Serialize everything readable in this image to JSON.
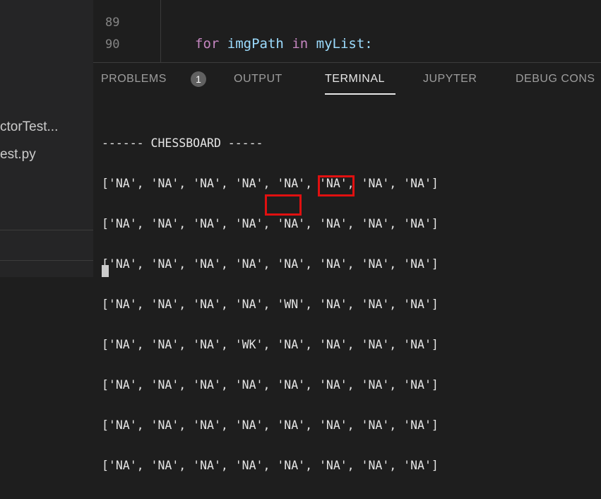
{
  "sidebar": {
    "files": [
      "ctorTest...",
      "est.py"
    ]
  },
  "editor": {
    "line_numbers": [
      "89",
      "90"
    ],
    "code": {
      "kw_for": "for",
      "var": "imgPath",
      "kw_in": "in",
      "rest": "myList:"
    }
  },
  "panel": {
    "tabs": [
      {
        "label": "PROBLEMS",
        "badge": "1"
      },
      {
        "label": "OUTPUT"
      },
      {
        "label": "TERMINAL",
        "active": true
      },
      {
        "label": "JUPYTER"
      },
      {
        "label": "DEBUG CONS"
      }
    ]
  },
  "terminal": {
    "heading": "------ CHESSBOARD -----",
    "rows": [
      "['NA', 'NA', 'NA', 'NA', 'NA', 'NA', 'NA', 'NA']",
      "['NA', 'NA', 'NA', 'NA', 'NA', 'NA', 'NA', 'NA']",
      "['NA', 'NA', 'NA', 'NA', 'NA', 'NA', 'NA', 'NA']",
      "['NA', 'NA', 'NA', 'NA', 'WN', 'NA', 'NA', 'NA']",
      "['NA', 'NA', 'NA', 'WK', 'NA', 'NA', 'NA', 'NA']",
      "['NA', 'NA', 'NA', 'NA', 'NA', 'NA', 'NA', 'NA']",
      "['NA', 'NA', 'NA', 'NA', 'NA', 'NA', 'NA', 'NA']",
      "['NA', 'NA', 'NA', 'NA', 'NA', 'NA', 'NA', 'NA']"
    ]
  },
  "colors": {
    "highlight": "#e01010",
    "keyword": "#c586c0",
    "variable": "#9cdcfe"
  }
}
